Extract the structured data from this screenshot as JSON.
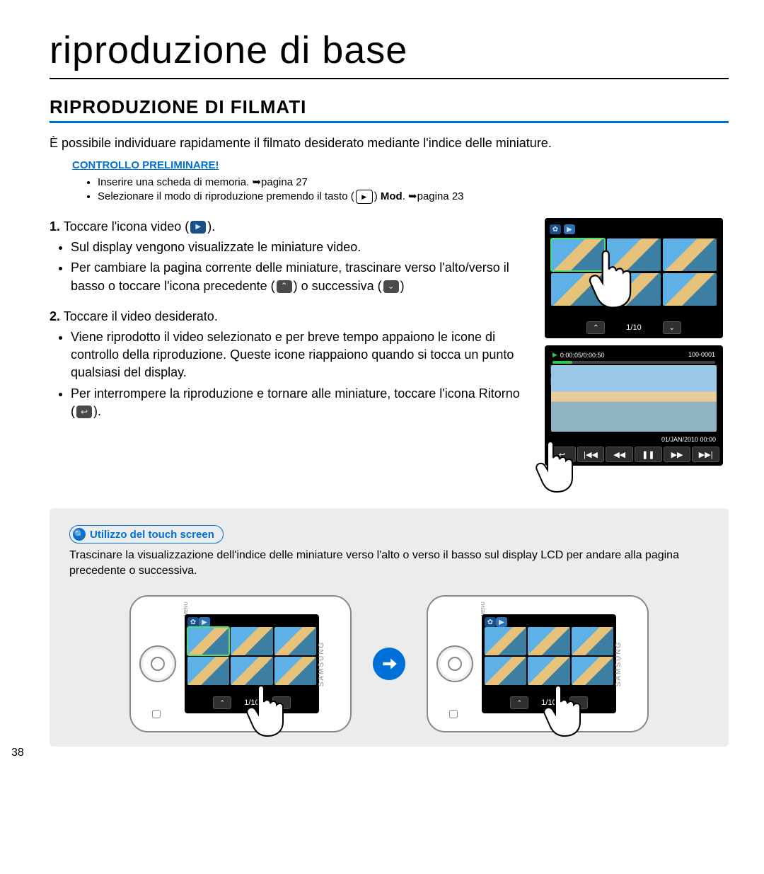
{
  "page_number": "38",
  "title": "riproduzione di base",
  "section_heading": "RIPRODUZIONE DI FILMATI",
  "intro": "È possibile individuare rapidamente il filmato desiderato mediante l'indice delle miniature.",
  "prelim_label": "CONTROLLO PRELIMINARE!",
  "prelim_items": {
    "a": "Inserire una scheda di memoria. ➥pagina 27",
    "b_pre": "Selezionare il modo di riproduzione premendo il tasto (",
    "b_mid": ") ",
    "b_mod": "Mod",
    "b_post": ". ➥pagina 23"
  },
  "steps": {
    "s1_label": "1.",
    "s1_text": "Toccare l'icona video (",
    "s1_text_post": ").",
    "s1_b1": "Sul display vengono visualizzate le miniature video.",
    "s1_b2a": "Per cambiare la pagina corrente delle miniature, trascinare verso l'alto/verso il basso o toccare l'icona precedente (",
    "s1_b2b": ") o successiva (",
    "s1_b2c": ")",
    "s2_label": "2.",
    "s2_text": "Toccare il video desiderato.",
    "s2_b1": "Viene riprodotto il video selezionato e per breve tempo appaiono le icone di controllo della riproduzione. Queste icone riappaiono quando si tocca un punto qualsiasi del display.",
    "s2_b2a": "Per interrompere la riproduzione e tornare alle miniature, toccare l'icona Ritorno (",
    "s2_b2b": ")."
  },
  "screen1": {
    "page_counter": "1/10"
  },
  "screen2": {
    "time": "0:00:05/0:00:50",
    "clip_id": "100-0001",
    "date": "01/JAN/2010  00:00"
  },
  "tip": {
    "title": "Utilizzo del touch screen",
    "text": "Trascinare la visualizzazione dell'indice delle miniature verso l'alto o verso il basso sul display LCD per andare alla pagina precedente o successiva."
  },
  "device": {
    "page_counter": "1/10",
    "brand": "SAMSUNG",
    "menu": "MENU"
  }
}
